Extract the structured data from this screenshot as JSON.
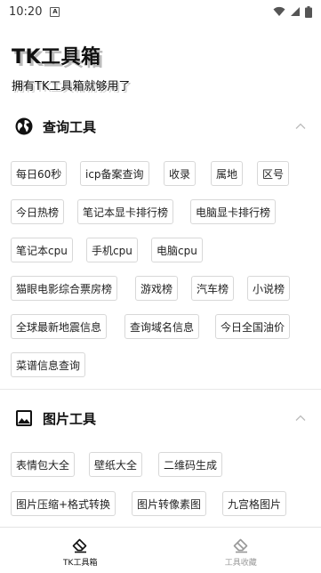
{
  "status_bar": {
    "time": "10:20",
    "sim_label": "A"
  },
  "header": {
    "title": "TK工具箱",
    "subtitle": "拥有TK工具箱就够用了"
  },
  "sections": [
    {
      "title": "查询工具",
      "icon": "globe-icon",
      "items": [
        "每日60秒",
        "icp备案查询",
        "收录",
        "属地",
        "区号",
        "今日热榜",
        "笔记本显卡排行榜",
        "电脑显卡排行榜",
        "笔记本cpu",
        "手机cpu",
        "电脑cpu",
        "猫眼电影综合票房榜",
        "游戏榜",
        "汽车榜",
        "小说榜",
        "全球最新地震信息",
        "查询域名信息",
        "今日全国油价",
        "菜谱信息查询"
      ]
    },
    {
      "title": "图片工具",
      "icon": "image-icon",
      "items": [
        "表情包大全",
        "壁纸大全",
        "二维码生成",
        "图片压缩+格式转换",
        "图片转像素图",
        "九宫格图片"
      ]
    }
  ],
  "bottom_nav": [
    {
      "label": "TK工具箱",
      "icon": "eraser-icon",
      "active": true
    },
    {
      "label": "工具收藏",
      "icon": "eraser-icon",
      "active": false
    }
  ]
}
